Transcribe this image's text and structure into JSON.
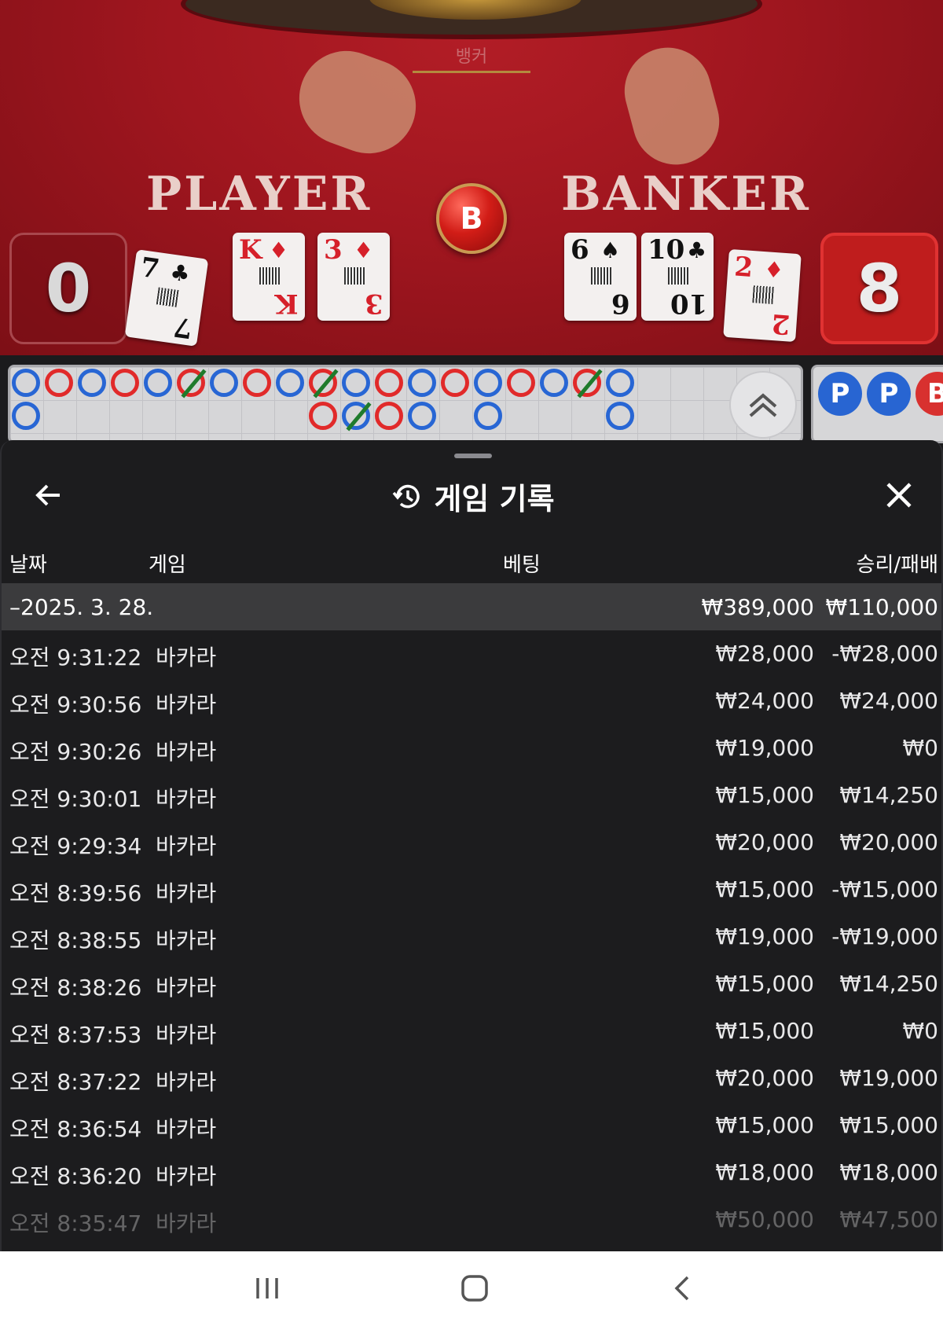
{
  "table": {
    "banker_top_label": "뱅커",
    "player_label": "PLAYER",
    "banker_label": "BANKER",
    "center_badge": "B",
    "player_score": "0",
    "banker_score": "8",
    "player_cards": [
      {
        "rank": "7",
        "suit": "♣",
        "color": "black"
      },
      {
        "rank": "K",
        "suit": "♦",
        "color": "red"
      },
      {
        "rank": "3",
        "suit": "♦",
        "color": "red"
      }
    ],
    "banker_cards": [
      {
        "rank": "6",
        "suit": "♠",
        "color": "black"
      },
      {
        "rank": "10",
        "suit": "♣",
        "color": "black"
      },
      {
        "rank": "2",
        "suit": "♦",
        "color": "red"
      }
    ]
  },
  "roadmap": {
    "beads_row1": [
      "P",
      "B",
      "P",
      "B",
      "P",
      "B*",
      "P",
      "B",
      "P",
      "B*",
      "P",
      "B",
      "P",
      "B",
      "P",
      "B",
      "P",
      "B*",
      "P"
    ],
    "beads_row2": [
      "P",
      "",
      "",
      "",
      "",
      "",
      "",
      "",
      "",
      "B",
      "P*",
      "B",
      "P",
      "",
      "P",
      "",
      "",
      "",
      "P"
    ],
    "side_balls": [
      "P",
      "P",
      "B"
    ]
  },
  "sheet": {
    "title": "게임 기록",
    "columns": {
      "date": "날짜",
      "game": "게임",
      "bet": "베팅",
      "win_loss": "승리/패배"
    },
    "date_group": {
      "date": "–2025. 3. 28.",
      "bet_total": "₩389,000",
      "win_total": "₩110,000"
    },
    "rows": [
      {
        "time": "오전 9:31:22",
        "game": "바카라",
        "bet": "₩28,000",
        "result": "-₩28,000"
      },
      {
        "time": "오전 9:30:56",
        "game": "바카라",
        "bet": "₩24,000",
        "result": "₩24,000"
      },
      {
        "time": "오전 9:30:26",
        "game": "바카라",
        "bet": "₩19,000",
        "result": "₩0"
      },
      {
        "time": "오전 9:30:01",
        "game": "바카라",
        "bet": "₩15,000",
        "result": "₩14,250"
      },
      {
        "time": "오전 9:29:34",
        "game": "바카라",
        "bet": "₩20,000",
        "result": "₩20,000"
      },
      {
        "time": "오전 8:39:56",
        "game": "바카라",
        "bet": "₩15,000",
        "result": "-₩15,000"
      },
      {
        "time": "오전 8:38:55",
        "game": "바카라",
        "bet": "₩19,000",
        "result": "-₩19,000"
      },
      {
        "time": "오전 8:38:26",
        "game": "바카라",
        "bet": "₩15,000",
        "result": "₩14,250"
      },
      {
        "time": "오전 8:37:53",
        "game": "바카라",
        "bet": "₩15,000",
        "result": "₩0"
      },
      {
        "time": "오전 8:37:22",
        "game": "바카라",
        "bet": "₩20,000",
        "result": "₩19,000"
      },
      {
        "time": "오전 8:36:54",
        "game": "바카라",
        "bet": "₩15,000",
        "result": "₩15,000"
      },
      {
        "time": "오전 8:36:20",
        "game": "바카라",
        "bet": "₩18,000",
        "result": "₩18,000"
      },
      {
        "time": "오전 8:35:47",
        "game": "바카라",
        "bet": "₩50,000",
        "result": "₩47,500"
      }
    ]
  },
  "colors": {
    "banker_red": "#e12a2a",
    "player_blue": "#2866d4",
    "tie_green": "#1f7b2c",
    "sheet_bg": "#1c1c1e"
  }
}
